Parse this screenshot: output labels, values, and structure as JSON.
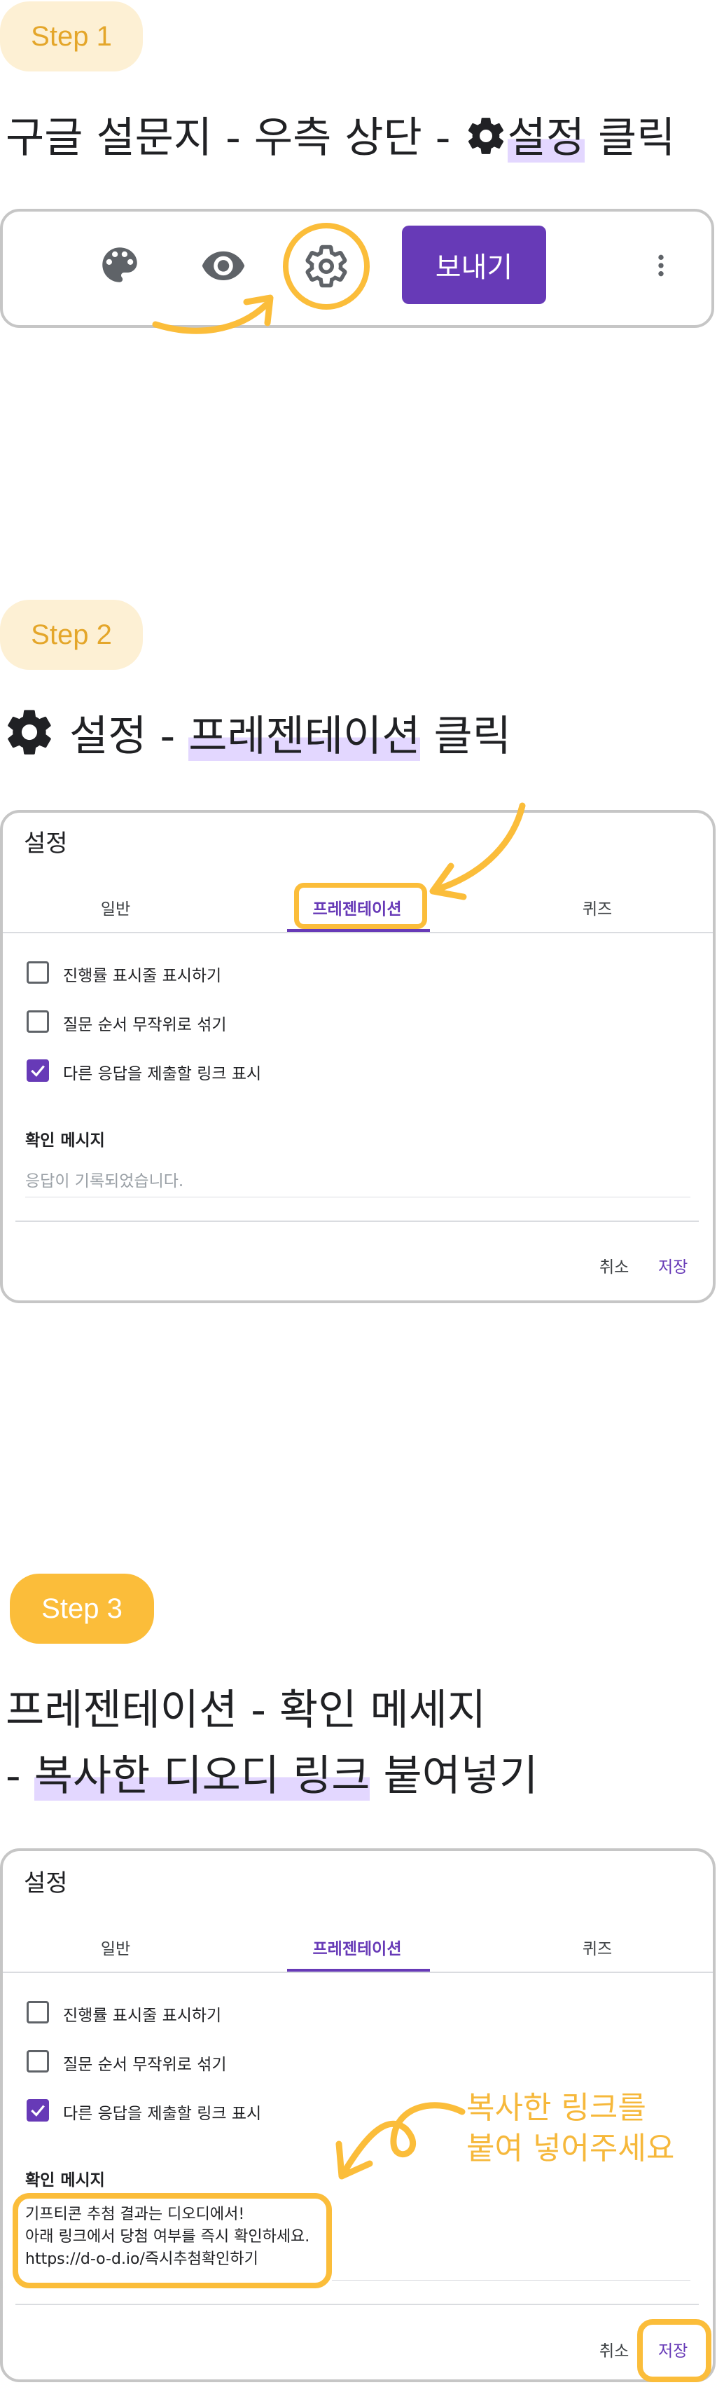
{
  "steps": [
    {
      "badge": "Step 1",
      "heading_prefix": "구글 설문지 - 우측 상단 - ",
      "heading_highlight": "설정",
      "heading_suffix": " 클릭",
      "toolbar": {
        "icons": [
          "palette-icon",
          "eye-icon",
          "gear-icon",
          "more-vert-icon"
        ],
        "send_label": "보내기"
      }
    },
    {
      "badge": "Step 2",
      "heading_prefix": " 설정 - ",
      "heading_highlight": "프레젠테이션",
      "heading_suffix": " 클릭"
    },
    {
      "badge": "Step 3",
      "heading_line1": "프레젠테이션 - 확인 메세지",
      "heading_line2_prefix": "- ",
      "heading_line2_highlight": "복사한 디오디 링크",
      "heading_line2_suffix": " 붙여넣기",
      "annotation_line1": "복사한 링크를",
      "annotation_line2": "붙여 넣어주세요"
    }
  ],
  "settings_dialog": {
    "title": "설정",
    "tabs": [
      "일반",
      "프레젠테이션",
      "퀴즈"
    ],
    "active_tab": "프레젠테이션",
    "options": [
      {
        "label": "진행률 표시줄 표시하기",
        "checked": false
      },
      {
        "label": "질문 순서 무작위로 섞기",
        "checked": false
      },
      {
        "label": "다른 응답을 제출할 링크 표시",
        "checked": true
      }
    ],
    "confirm_label": "확인 메시지",
    "confirm_placeholder": "응답이 기록되었습니다.",
    "confirm_message_lines": [
      "기프티콘 추첨 결과는 디오디에서!",
      "아래 링크에서 당첨 여부를 즉시 확인하세요.",
      "https://d-o-d.io/즉시추첨확인하기"
    ],
    "cancel_label": "취소",
    "save_label": "저장"
  },
  "colors": {
    "accent_purple": "#673ab7",
    "highlight_orange": "#fbbd3a",
    "highlight_lavender": "#e3d7ff"
  }
}
